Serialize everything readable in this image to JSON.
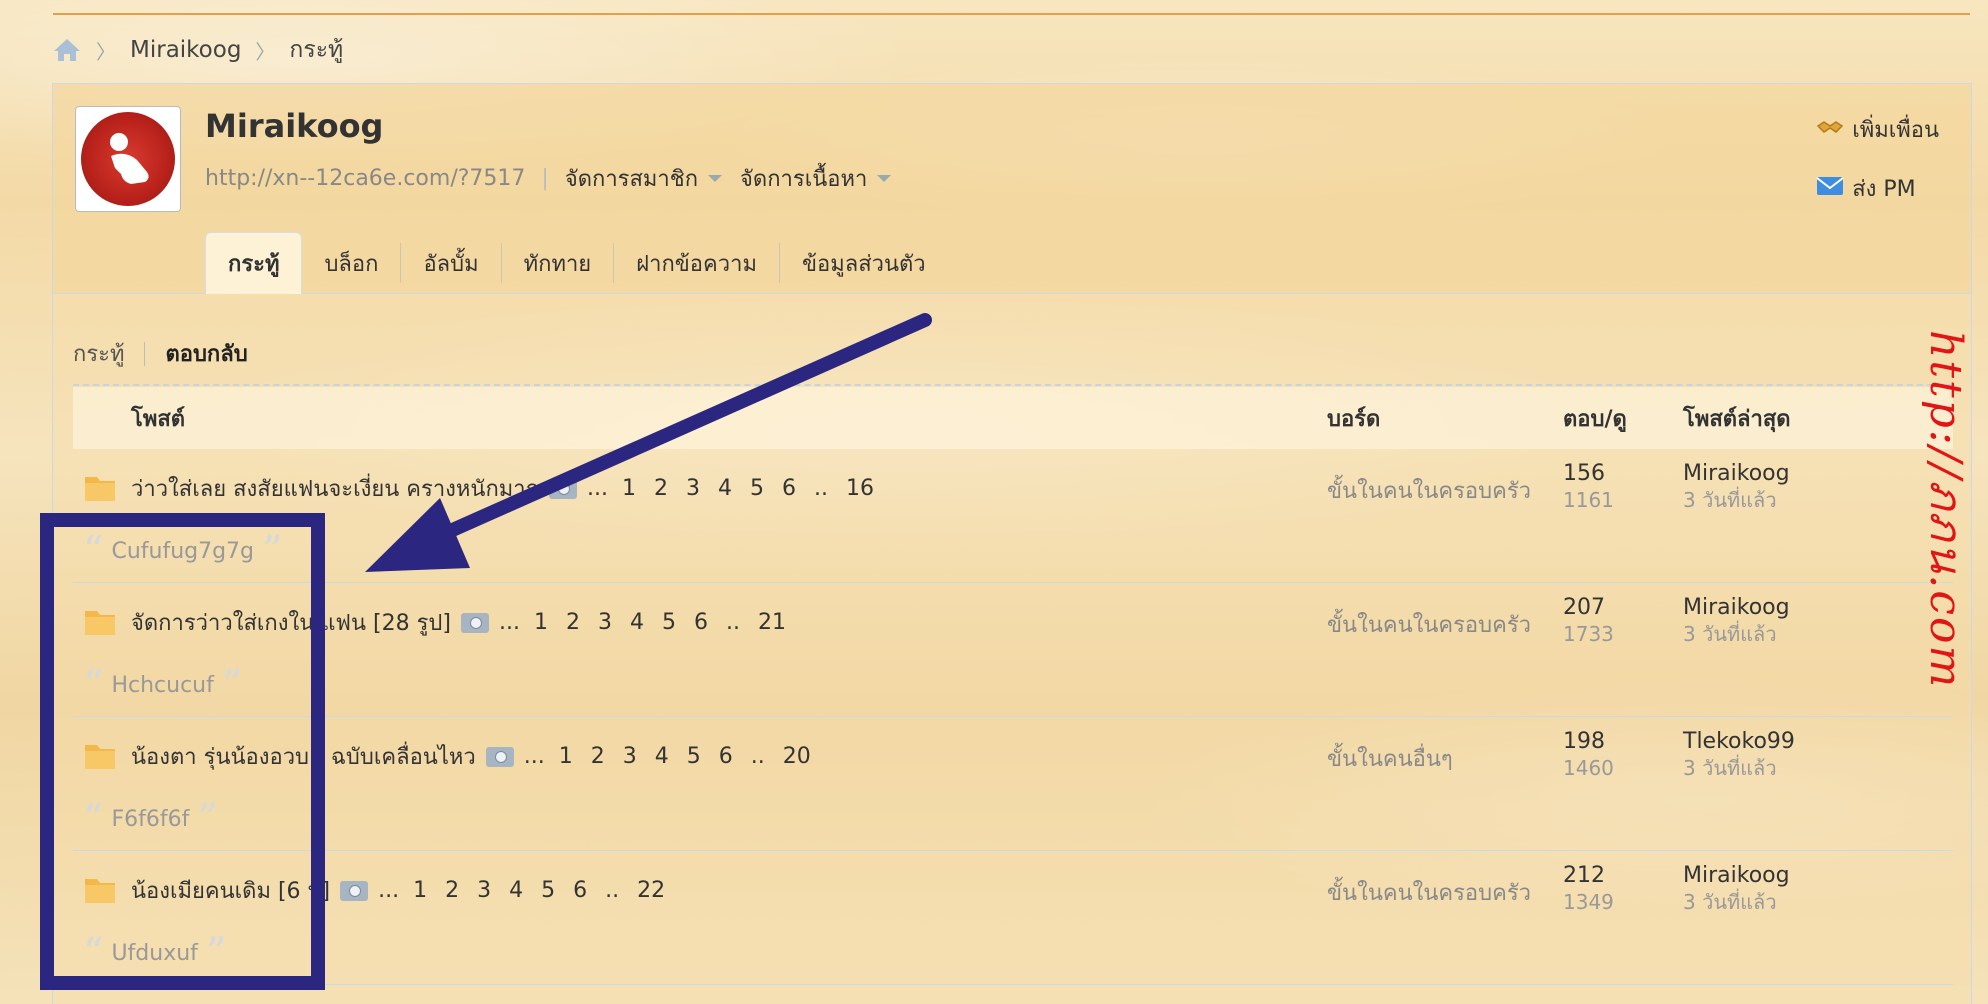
{
  "breadcrumb": {
    "home": "home-icon",
    "items": [
      "Miraikoog",
      "กระทู้"
    ]
  },
  "profile": {
    "username": "Miraikoog",
    "url": "http://xn--12ca6e.com/?7517",
    "menus": [
      "จัดการสมาชิก",
      "จัดการเนื้อหา"
    ],
    "actions": [
      {
        "label": "เพิ่มเพื่อน",
        "icon": "handshake-icon"
      },
      {
        "label": "ส่ง PM",
        "icon": "envelope-icon"
      }
    ]
  },
  "tabs": [
    "กระทู้",
    "บล็อก",
    "อัลบั้ม",
    "ทักทาย",
    "ฝากข้อความ",
    "ข้อมูลส่วนตัว"
  ],
  "active_tab": "กระทู้",
  "subtabs": [
    "กระทู้",
    "ตอบกลับ"
  ],
  "active_subtab": "ตอบกลับ",
  "table": {
    "headers": {
      "post": "โพสต์",
      "board": "บอร์ด",
      "reply_view": "ตอบ/ดู",
      "last_post": "โพสต์ล่าสุด"
    },
    "rows": [
      {
        "title": "ว่าวใส่เลย สงสัยแฟนจะเงี่ยน ครางหนักมาก",
        "ellipsis": "...",
        "pages": [
          "1",
          "2",
          "3",
          "4",
          "5",
          "6",
          ".."
        ],
        "last_page": "16",
        "quote": "Cufufug7g7g",
        "board": "ขั้นในคนในครอบครัว",
        "replies": "156",
        "views": "1161",
        "last_user": "Miraikoog",
        "last_time": "3 วันที่แล้ว"
      },
      {
        "title": "จัดการว่าวใส่เกงใน แฟน [28 รูป]",
        "ellipsis": "...",
        "pages": [
          "1",
          "2",
          "3",
          "4",
          "5",
          "6",
          ".."
        ],
        "last_page": "21",
        "quote": "Hchcucuf",
        "board": "ขั้นในคนในครอบครัว",
        "replies": "207",
        "views": "1733",
        "last_user": "Miraikoog",
        "last_time": "3 วันที่แล้ว"
      },
      {
        "title": "น้องตา รุ่นน้องอวบ - ฉบับเคลื่อนไหว",
        "ellipsis": "...",
        "pages": [
          "1",
          "2",
          "3",
          "4",
          "5",
          "6",
          ".."
        ],
        "last_page": "20",
        "quote": "F6f6f6f",
        "board": "ขั้นในคนอื่นๆ",
        "replies": "198",
        "views": "1460",
        "last_user": "Tlekoko99",
        "last_time": "3 วันที่แล้ว"
      },
      {
        "title": "น้องเมียคนเดิม [6 ป]",
        "ellipsis": "...",
        "pages": [
          "1",
          "2",
          "3",
          "4",
          "5",
          "6",
          ".."
        ],
        "last_page": "22",
        "quote": "Ufduxuf",
        "board": "ขั้นในคนในครอบครัว",
        "replies": "212",
        "views": "1349",
        "last_user": "Miraikoog",
        "last_time": "3 วันที่แล้ว"
      }
    ]
  },
  "watermark": "http://ภภน.com",
  "colors": {
    "annotation": "#2b2680",
    "watermark": "#e31414",
    "accent_rule": "#e3a04a"
  }
}
